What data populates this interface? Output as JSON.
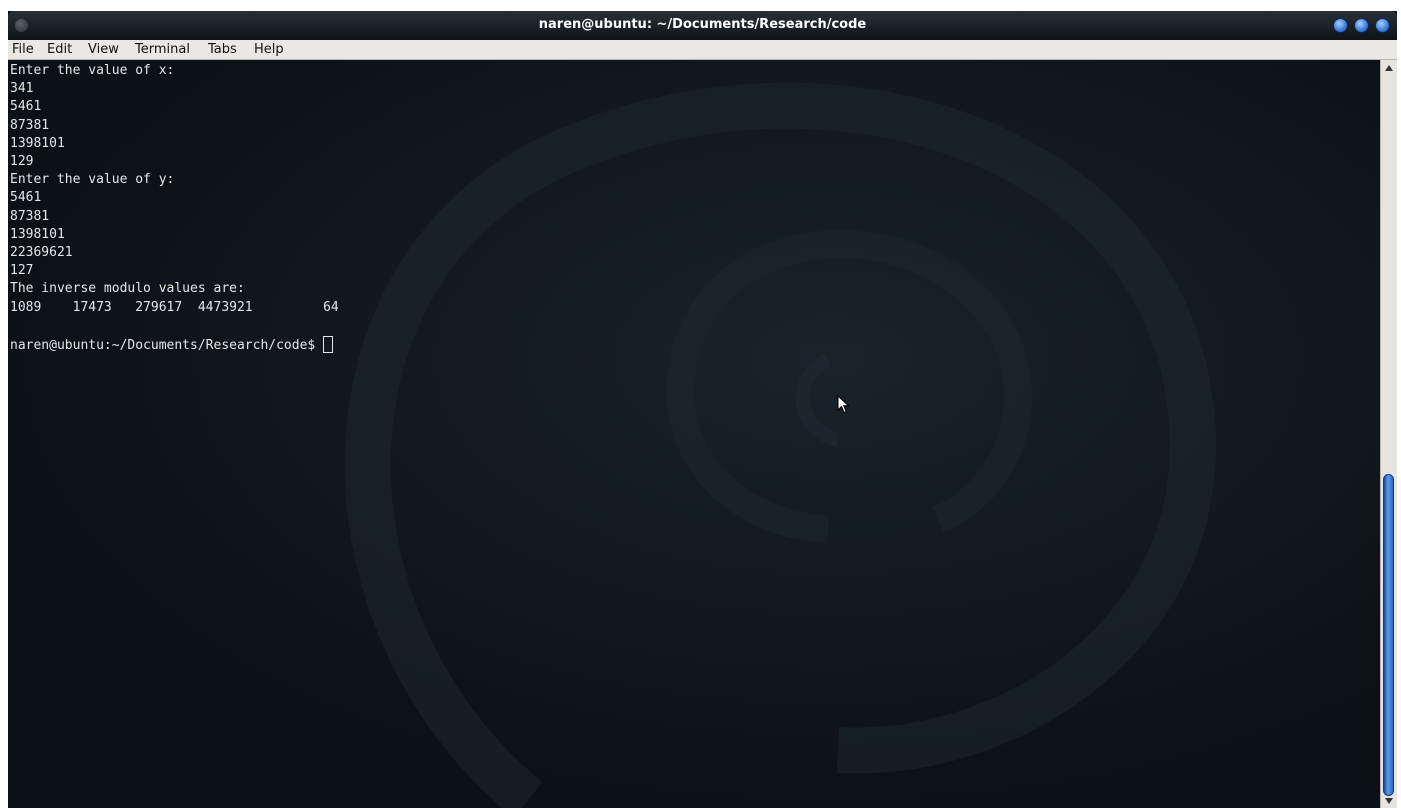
{
  "window": {
    "title": "naren@ubuntu: ~/Documents/Research/code"
  },
  "menubar": {
    "items": [
      {
        "label": "File"
      },
      {
        "label": "Edit"
      },
      {
        "label": "View"
      },
      {
        "label": "Terminal"
      },
      {
        "label": "Tabs"
      },
      {
        "label": "Help"
      }
    ]
  },
  "terminal": {
    "output_lines": [
      "Enter the value of x:",
      "341",
      "5461",
      "87381",
      "1398101",
      "129",
      "Enter the value of y:",
      "5461",
      "87381",
      "1398101",
      "22369621",
      "127",
      "The inverse modulo values are:",
      "1089    17473   279617  4473921         64",
      ""
    ],
    "prompt": "naren@ubuntu:~/Documents/Research/code$ ",
    "input_value": ""
  },
  "colors": {
    "terminal_background": "#0b1116",
    "terminal_text": "#e6e6e6",
    "accent": "#3a7ad8"
  },
  "icons": {
    "window_menu": "window-menu-icon",
    "minimize": "minimize-icon",
    "maximize": "maximize-icon",
    "close": "close-icon",
    "pointer": "mouse-pointer-icon"
  }
}
